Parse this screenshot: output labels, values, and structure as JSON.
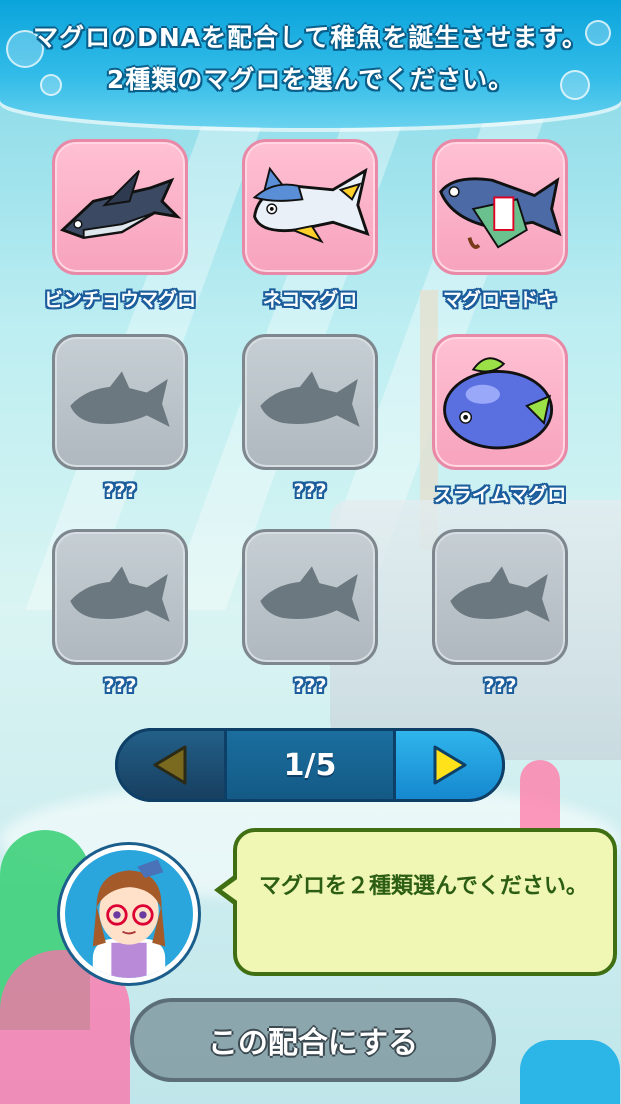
{
  "header": {
    "line1": "マグロのDNAを配合して稚魚を誕生させます。",
    "line2": "2種類のマグロを選んでください。"
  },
  "tunas": [
    {
      "name": "ビンチョウマグロ",
      "state": "owned",
      "icon": "albacore-tuna-icon"
    },
    {
      "name": "ネコマグロ",
      "state": "owned",
      "icon": "cat-tuna-icon"
    },
    {
      "name": "マグロモドキ",
      "state": "owned",
      "icon": "fake-tuna-icon"
    },
    {
      "name": "???",
      "state": "locked",
      "icon": "tuna-silhouette-icon"
    },
    {
      "name": "???",
      "state": "locked",
      "icon": "tuna-silhouette-icon"
    },
    {
      "name": "スライムマグロ",
      "state": "owned",
      "icon": "slime-tuna-icon"
    },
    {
      "name": "???",
      "state": "locked",
      "icon": "tuna-silhouette-icon"
    },
    {
      "name": "???",
      "state": "locked",
      "icon": "tuna-silhouette-icon"
    },
    {
      "name": "???",
      "state": "locked",
      "icon": "tuna-silhouette-icon"
    }
  ],
  "pager": {
    "page": "1/5",
    "prev_icon": "arrow-left-icon",
    "next_icon": "arrow-right-icon"
  },
  "guide": {
    "message": "マグロを２種類選んでください。"
  },
  "confirm_label": "この配合にする",
  "colors": {
    "owned_tile": "#f7a3bd",
    "locked_tile": "#aeb8be",
    "header_blue": "#0aa4dc",
    "next_arrow": "#ffe21a"
  }
}
